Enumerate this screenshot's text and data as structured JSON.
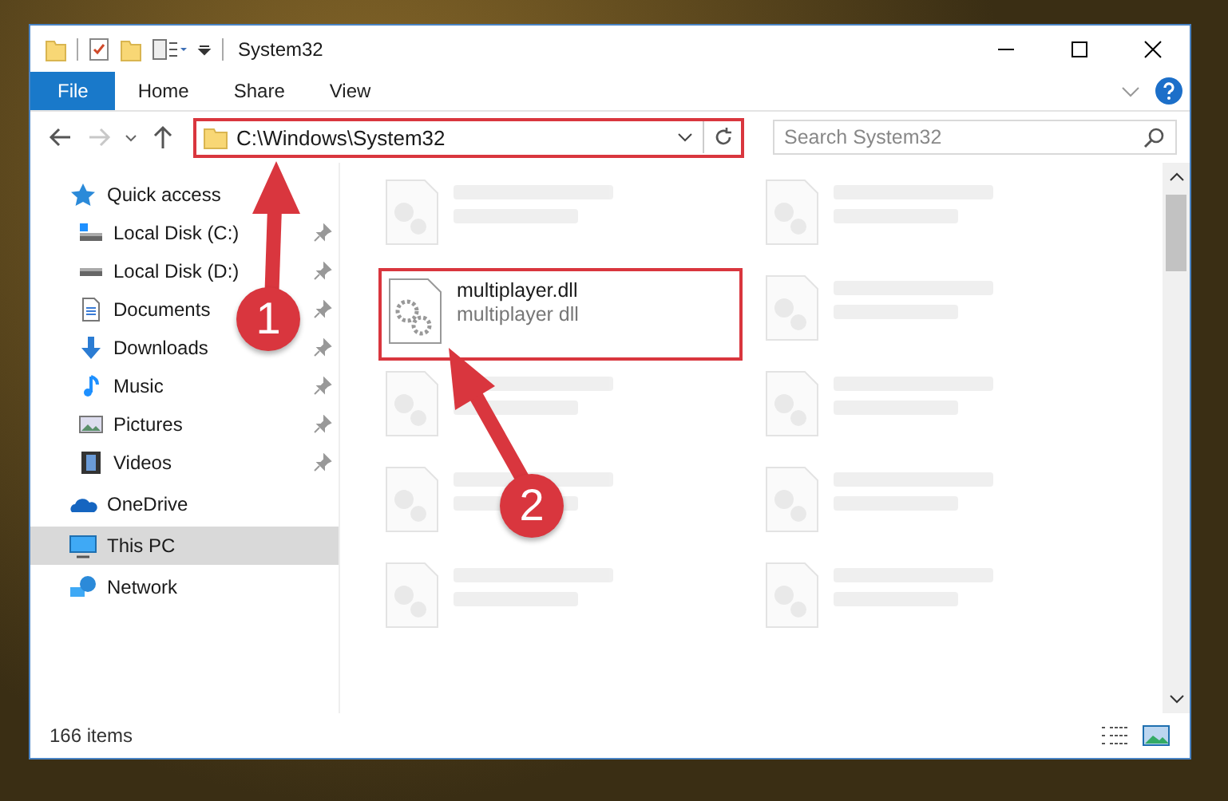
{
  "window": {
    "title": "System32"
  },
  "ribbon_tabs": [
    {
      "label": "File",
      "selected": true
    },
    {
      "label": "Home",
      "selected": false
    },
    {
      "label": "Share",
      "selected": false
    },
    {
      "label": "View",
      "selected": false
    }
  ],
  "address": {
    "value": "C:\\Windows\\System32",
    "highlighted": true
  },
  "search": {
    "placeholder": "Search System32"
  },
  "sidebar": {
    "items": [
      {
        "label": "Quick access",
        "selected": false,
        "children": [
          {
            "label": "Local Disk (C:)",
            "pinned": true
          },
          {
            "label": "Local Disk (D:)",
            "pinned": true
          },
          {
            "label": "Documents",
            "pinned": true
          },
          {
            "label": "Downloads",
            "pinned": true
          },
          {
            "label": "Music",
            "pinned": true
          },
          {
            "label": "Pictures",
            "pinned": true
          },
          {
            "label": "Videos",
            "pinned": true
          }
        ]
      },
      {
        "label": "OneDrive",
        "selected": false
      },
      {
        "label": "This PC",
        "selected": true
      },
      {
        "label": "Network",
        "selected": false
      }
    ]
  },
  "files": [
    {
      "kind": "blurred",
      "highlighted": false
    },
    {
      "kind": "blurred",
      "highlighted": false
    },
    {
      "name": "multiplayer.dll",
      "type": "multiplayer dll",
      "kind": "plain",
      "highlighted": true
    },
    {
      "kind": "blurred",
      "highlighted": false
    },
    {
      "kind": "blurred",
      "highlighted": false
    },
    {
      "kind": "blurred",
      "highlighted": false
    },
    {
      "kind": "blurred",
      "highlighted": false
    },
    {
      "kind": "blurred",
      "highlighted": false
    },
    {
      "kind": "blurred",
      "highlighted": false
    },
    {
      "kind": "blurred",
      "highlighted": false
    }
  ],
  "status_bar": {
    "count": "166 items"
  },
  "annotations": [
    {
      "label": "1"
    },
    {
      "label": "2"
    }
  ]
}
